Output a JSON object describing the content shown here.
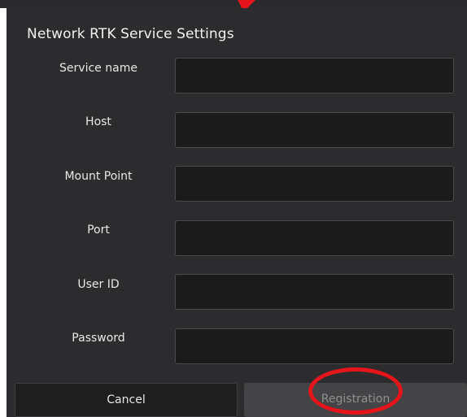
{
  "dialog": {
    "title": "Network RTK Service Settings"
  },
  "fields": [
    {
      "label": "Service name",
      "value": ""
    },
    {
      "label": "Host",
      "value": ""
    },
    {
      "label": "Mount Point",
      "value": ""
    },
    {
      "label": "Port",
      "value": ""
    },
    {
      "label": "User ID",
      "value": ""
    },
    {
      "label": "Password",
      "value": ""
    }
  ],
  "buttons": {
    "cancel_label": "Cancel",
    "registration_label": "Registration"
  },
  "colors": {
    "dialog_background": "#2c2c2e",
    "input_background": "#1b1b1b",
    "registration_disabled": "#444446",
    "annotation_red": "#e5151b"
  }
}
